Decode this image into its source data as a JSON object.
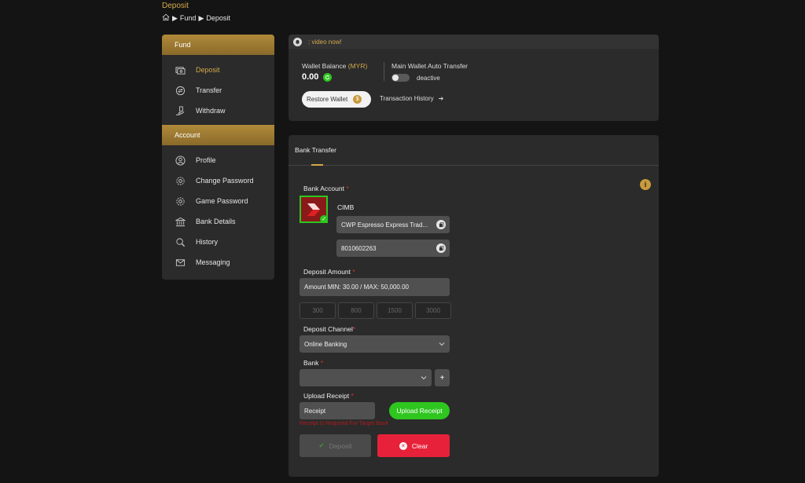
{
  "page": {
    "title": "Deposit"
  },
  "breadcrumb": {
    "items": [
      "Fund",
      "Deposit"
    ]
  },
  "sidebar": {
    "fund_header": "Fund",
    "fund_items": [
      {
        "label": "Deposit",
        "icon": "deposit-icon"
      },
      {
        "label": "Transfer",
        "icon": "transfer-icon"
      },
      {
        "label": "Withdraw",
        "icon": "withdraw-icon"
      }
    ],
    "account_header": "Account",
    "account_items": [
      {
        "label": "Profile",
        "icon": "profile-icon"
      },
      {
        "label": "Change Password",
        "icon": "gear-icon"
      },
      {
        "label": "Game Password",
        "icon": "gear-icon"
      },
      {
        "label": "Bank Details",
        "icon": "bank-icon"
      },
      {
        "label": "History",
        "icon": "search-icon"
      },
      {
        "label": "Messaging",
        "icon": "mail-icon"
      }
    ]
  },
  "notice": {
    "text": ": video now!"
  },
  "wallet": {
    "balance_label": "Wallet Balance",
    "currency": "(MYR)",
    "balance": "0.00",
    "auto_transfer_label": "Main Wallet Auto Transfer",
    "auto_transfer_state": "deactive",
    "restore_label": "Restore Wallet",
    "history_label": "Transaction History"
  },
  "form": {
    "tab": "Bank Transfer",
    "bank_account_label": "Bank Account",
    "bank_name": "CIMB",
    "account_name": "CWP Espresso Express Trad...",
    "account_number": "8010602263",
    "deposit_amount_label": "Deposit Amount",
    "amount_placeholder": "Amount MIN: 30.00 / MAX: 50,000.00",
    "quick_amounts": [
      "300",
      "800",
      "1500",
      "3000"
    ],
    "channel_label": "Deposit Channel",
    "channel_value": "Online Banking",
    "bank_label": "Bank",
    "bank_value": "",
    "add_bank": "+",
    "upload_label": "Upload Receipt",
    "receipt_placeholder": "Receipt",
    "upload_button": "Upload Receipt",
    "error": "Receipt Is Required For Target Bank",
    "deposit_button": "Deposit",
    "clear_button": "Clear"
  },
  "colors": {
    "accent": "#d4a94a",
    "green": "#2ec61f",
    "red": "#e8213a"
  }
}
